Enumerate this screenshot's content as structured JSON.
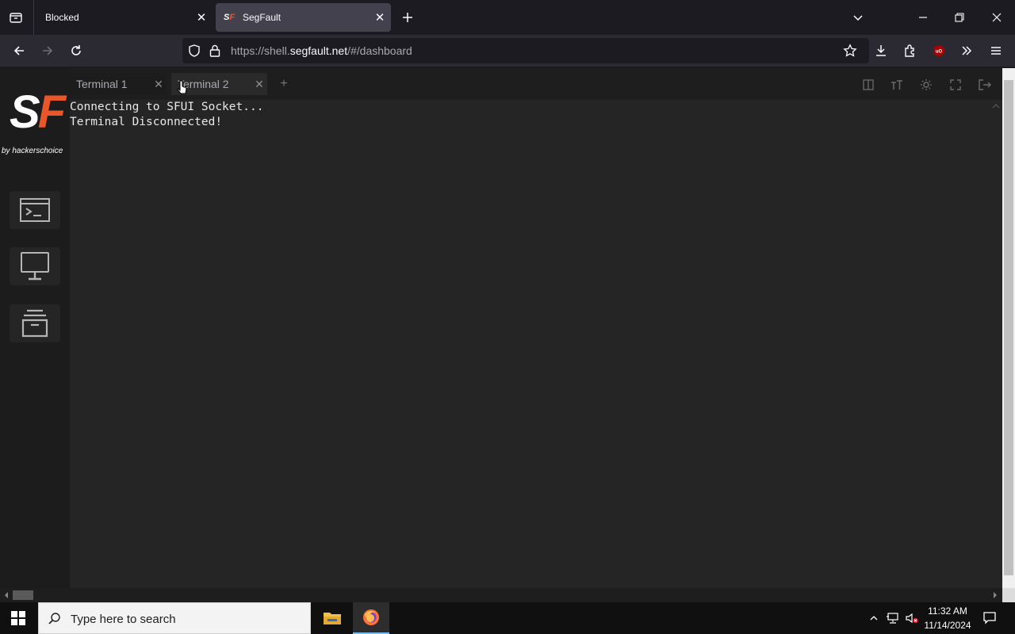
{
  "browser": {
    "tabs": [
      {
        "label": "Blocked",
        "active": false
      },
      {
        "label": "SegFault",
        "active": true
      }
    ],
    "url_prefix": "https://shell.",
    "url_domain": "segfault.net",
    "url_suffix": "/#/dashboard"
  },
  "app": {
    "logo_s": "S",
    "logo_f": "F",
    "logo_subtitle": "by hackerschoice",
    "brand_color": "#e8562a",
    "terminal_tabs": [
      {
        "label": "Terminal 1"
      },
      {
        "label": "Terminal 2"
      }
    ],
    "add_tab_label": "+",
    "terminal_lines": [
      "Connecting to SFUI Socket...",
      "Terminal Disconnected!"
    ]
  },
  "taskbar": {
    "search_placeholder": "Type here to search",
    "time": "11:32 AM",
    "date": "11/14/2024"
  }
}
